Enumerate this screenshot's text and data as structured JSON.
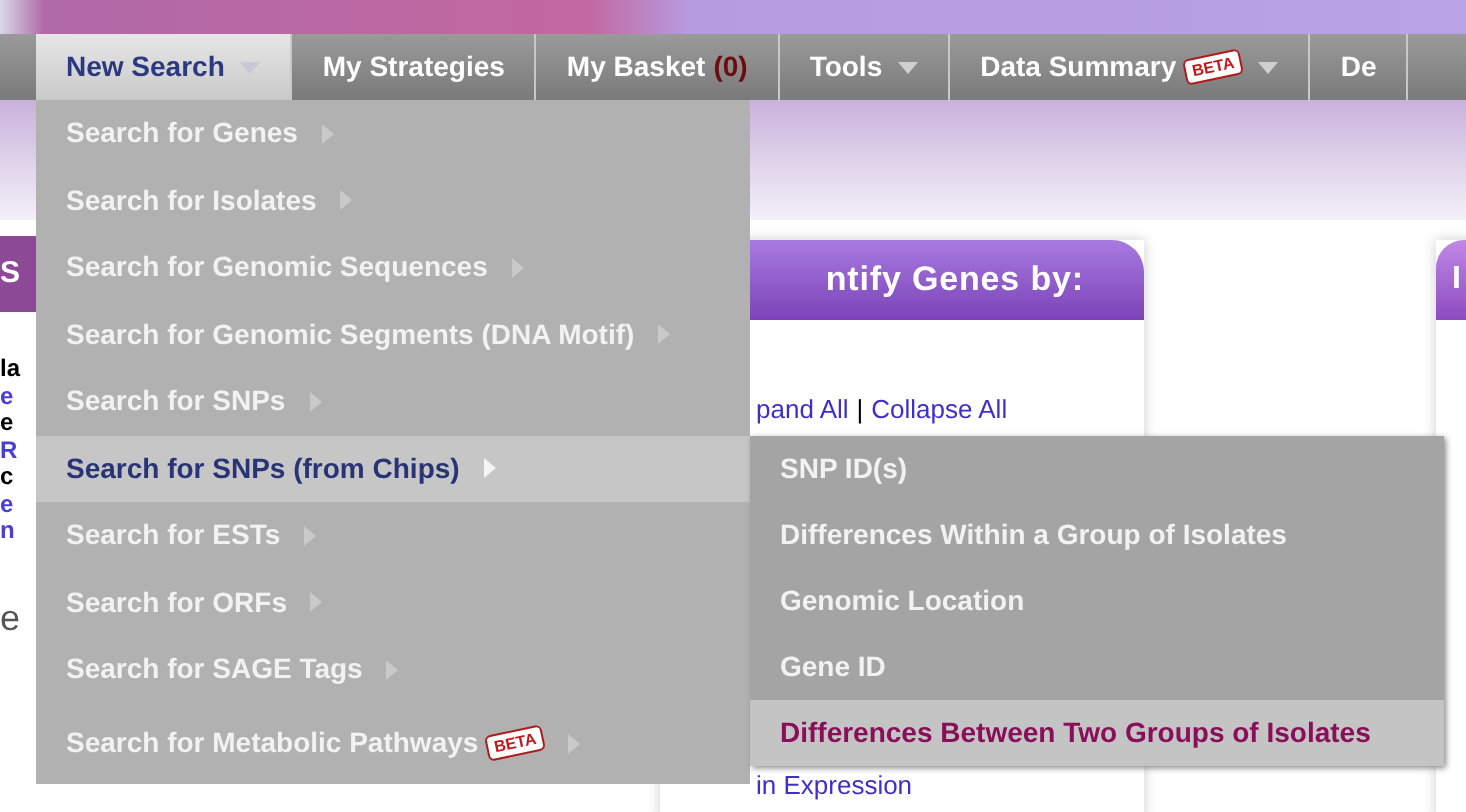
{
  "nav": [
    {
      "label": "New Search",
      "dropdown": true,
      "selected": true
    },
    {
      "label": "My Strategies",
      "dropdown": false,
      "selected": false
    },
    {
      "label": "My Basket",
      "count": "(0)",
      "dropdown": false,
      "selected": false
    },
    {
      "label": "Tools",
      "dropdown": true,
      "selected": false
    },
    {
      "label": "Data Summary",
      "badge": "BETA",
      "dropdown": true,
      "selected": false
    },
    {
      "label": "De",
      "dropdown": false,
      "selected": false
    }
  ],
  "left_panel": {
    "header": "S",
    "lines": [
      {
        "text": "la",
        "kind": "plain"
      },
      {
        "text": "e",
        "kind": "link"
      },
      {
        "text": "e",
        "kind": "plain"
      },
      {
        "text": "R",
        "kind": "link"
      },
      {
        "text": "c",
        "kind": "plain"
      },
      {
        "text": "e",
        "kind": "link"
      },
      {
        "text": "n",
        "kind": "link"
      }
    ],
    "footer": "e"
  },
  "center_panel": {
    "header": "ntify Genes by:",
    "links": [
      {
        "text": "pand All"
      },
      {
        "text": "Collapse All"
      }
    ],
    "separator": "|",
    "bottom_link": "in Expression"
  },
  "right_panel": {
    "header": "I"
  },
  "menu": [
    {
      "label": "Search for Genes",
      "selected": false
    },
    {
      "label": "Search for Isolates",
      "selected": false
    },
    {
      "label": "Search for Genomic Sequences",
      "selected": false
    },
    {
      "label": "Search for Genomic Segments (DNA Motif)",
      "selected": false
    },
    {
      "label": "Search for SNPs",
      "selected": false
    },
    {
      "label": "Search for SNPs (from Chips)",
      "selected": true
    },
    {
      "label": "Search for ESTs",
      "selected": false
    },
    {
      "label": "Search for ORFs",
      "selected": false
    },
    {
      "label": "Search for SAGE Tags",
      "selected": false
    },
    {
      "label": "Search for Metabolic Pathways",
      "badge": "BETA",
      "selected": false
    }
  ],
  "submenu": [
    {
      "label": "SNP ID(s)",
      "selected": false
    },
    {
      "label": "Differences Within a Group of Isolates",
      "selected": false
    },
    {
      "label": "Genomic Location",
      "selected": false
    },
    {
      "label": "Gene ID",
      "selected": false
    },
    {
      "label": "Differences Between Two Groups of Isolates",
      "selected": true
    }
  ]
}
